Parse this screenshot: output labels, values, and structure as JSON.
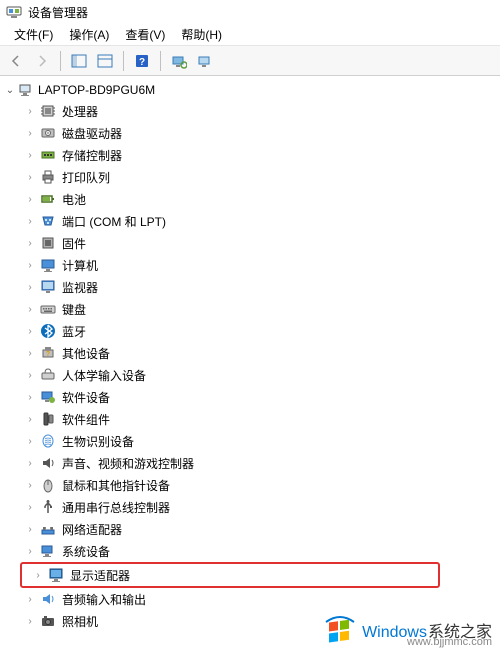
{
  "window": {
    "title": "设备管理器"
  },
  "menu": {
    "file": "文件(F)",
    "action": "操作(A)",
    "view": "查看(V)",
    "help": "帮助(H)"
  },
  "tree": {
    "root": "LAPTOP-BD9PGU6M",
    "items": [
      {
        "label": "处理器",
        "icon": "cpu"
      },
      {
        "label": "磁盘驱动器",
        "icon": "disk"
      },
      {
        "label": "存储控制器",
        "icon": "storage"
      },
      {
        "label": "打印队列",
        "icon": "printer"
      },
      {
        "label": "电池",
        "icon": "battery"
      },
      {
        "label": "端口 (COM 和 LPT)",
        "icon": "port"
      },
      {
        "label": "固件",
        "icon": "firmware"
      },
      {
        "label": "计算机",
        "icon": "computer"
      },
      {
        "label": "监视器",
        "icon": "monitor"
      },
      {
        "label": "键盘",
        "icon": "keyboard"
      },
      {
        "label": "蓝牙",
        "icon": "bluetooth"
      },
      {
        "label": "其他设备",
        "icon": "other"
      },
      {
        "label": "人体学输入设备",
        "icon": "hid"
      },
      {
        "label": "软件设备",
        "icon": "software"
      },
      {
        "label": "软件组件",
        "icon": "component"
      },
      {
        "label": "生物识别设备",
        "icon": "biometric"
      },
      {
        "label": "声音、视频和游戏控制器",
        "icon": "sound"
      },
      {
        "label": "鼠标和其他指针设备",
        "icon": "mouse"
      },
      {
        "label": "通用串行总线控制器",
        "icon": "usb"
      },
      {
        "label": "网络适配器",
        "icon": "network"
      },
      {
        "label": "系统设备",
        "icon": "system"
      },
      {
        "label": "显示适配器",
        "icon": "display",
        "highlighted": true
      },
      {
        "label": "音频输入和输出",
        "icon": "audio"
      },
      {
        "label": "照相机",
        "icon": "camera"
      }
    ]
  },
  "watermark": {
    "brand": "Windows",
    "text": "系统之家",
    "url": "www.bjjmmc.com"
  }
}
